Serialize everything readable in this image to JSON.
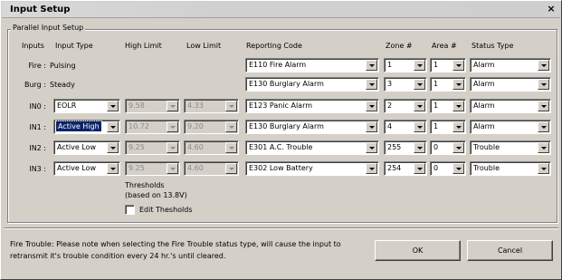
{
  "window": {
    "title": "Input Setup",
    "close_glyph": "×"
  },
  "group": {
    "label": "Parallel Input Setup"
  },
  "headers": {
    "inputs": "Inputs",
    "input_type": "Input Type",
    "high_limit": "High Limit",
    "low_limit": "Low Limit",
    "reporting_code": "Reporting Code",
    "zone": "Zone #",
    "area": "Area #",
    "status_type": "Status Type"
  },
  "rows": [
    {
      "label": "Fire :",
      "type": "Pulsing",
      "reporting_code": "E110 Fire Alarm",
      "zone": "1",
      "area": "1",
      "status": "Alarm"
    },
    {
      "label": "Burg :",
      "type": "Steady",
      "reporting_code": "E130 Burglary Alarm",
      "zone": "3",
      "area": "1",
      "status": "Alarm"
    },
    {
      "label": "IN0 :",
      "type": "EOLR",
      "high": "9.58",
      "low": "4.33",
      "reporting_code": "E123 Panic Alarm",
      "zone": "2",
      "area": "1",
      "status": "Alarm"
    },
    {
      "label": "IN1 :",
      "type": "Active High",
      "high": "10.72",
      "low": "9.20",
      "reporting_code": "E130 Burglary Alarm",
      "zone": "4",
      "area": "1",
      "status": "Alarm"
    },
    {
      "label": "IN2 :",
      "type": "Active Low",
      "high": "9.25",
      "low": "4.60",
      "reporting_code": "E301 A.C. Trouble",
      "zone": "255",
      "area": "0",
      "status": "Trouble"
    },
    {
      "label": "IN3 :",
      "type": "Active Low",
      "high": "9.25",
      "low": "4.60",
      "reporting_code": "E302 Low Battery",
      "zone": "254",
      "area": "0",
      "status": "Trouble"
    }
  ],
  "thresholds": {
    "line1": "Thresholds",
    "line2": "(based on 13.8V)",
    "edit_label": "Edit Thesholds",
    "edit_checked": false
  },
  "note": "Fire Trouble: Please note when selecting the Fire Trouble status type, will cause the input to retransmit it's trouble condition every 24 hr.'s until cleared.",
  "buttons": {
    "ok": "OK",
    "cancel": "Cancel"
  },
  "colors": {
    "face": "#d4d0c8",
    "selection": "#0a246a",
    "disabled_text": "#8a8a8a"
  }
}
